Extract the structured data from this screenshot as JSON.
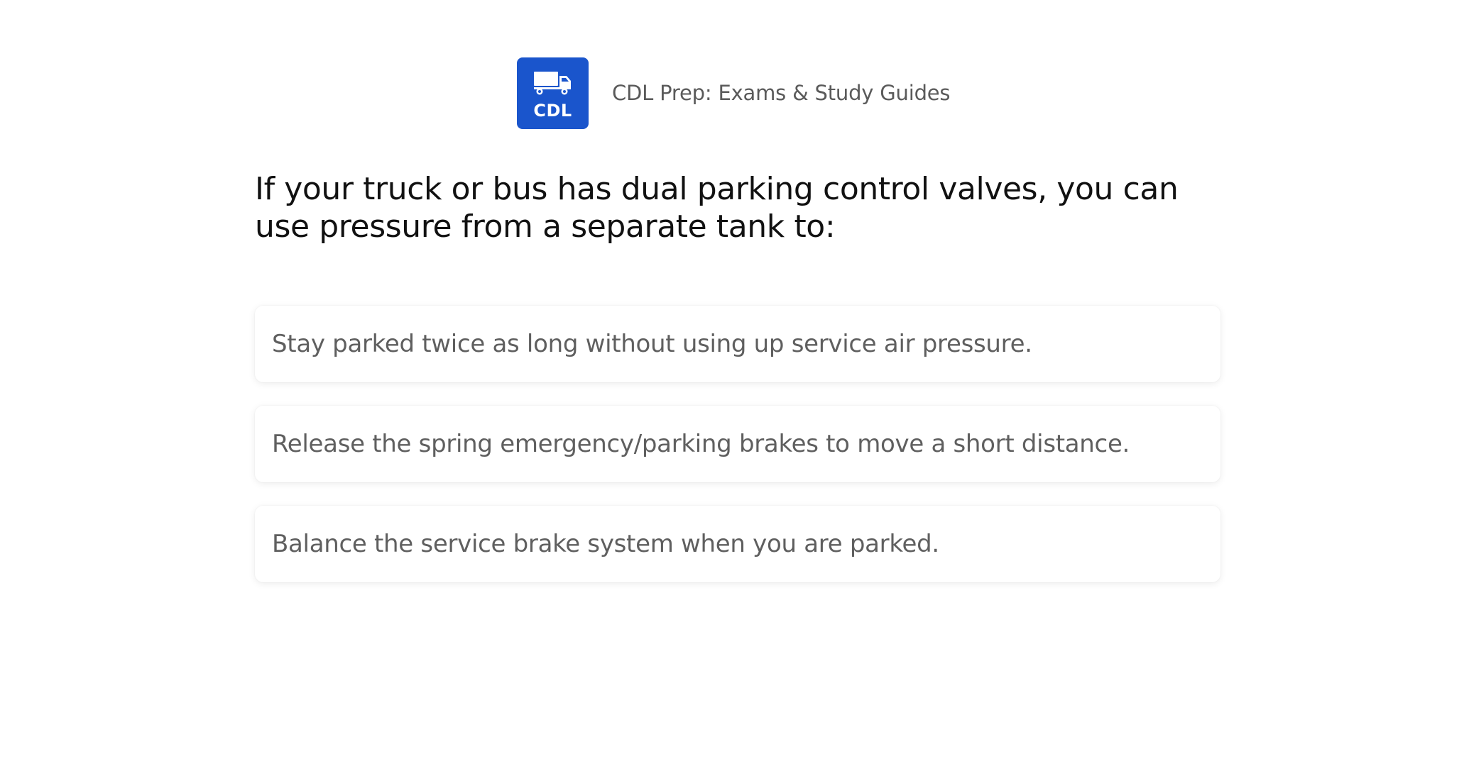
{
  "app": {
    "logo_text": "CDL",
    "title": "CDL Prep: Exams & Study Guides",
    "brand_color": "#1a55cc",
    "logo_icon": "truck-icon"
  },
  "question": {
    "text": "If your truck or bus has dual parking control valves, you can use pressure from a separate tank to:"
  },
  "answers": [
    {
      "label": "Stay parked twice as long without using up service air pressure."
    },
    {
      "label": "Release the spring emergency/parking brakes to move a short distance."
    },
    {
      "label": "Balance the service brake system when you are parked."
    }
  ]
}
